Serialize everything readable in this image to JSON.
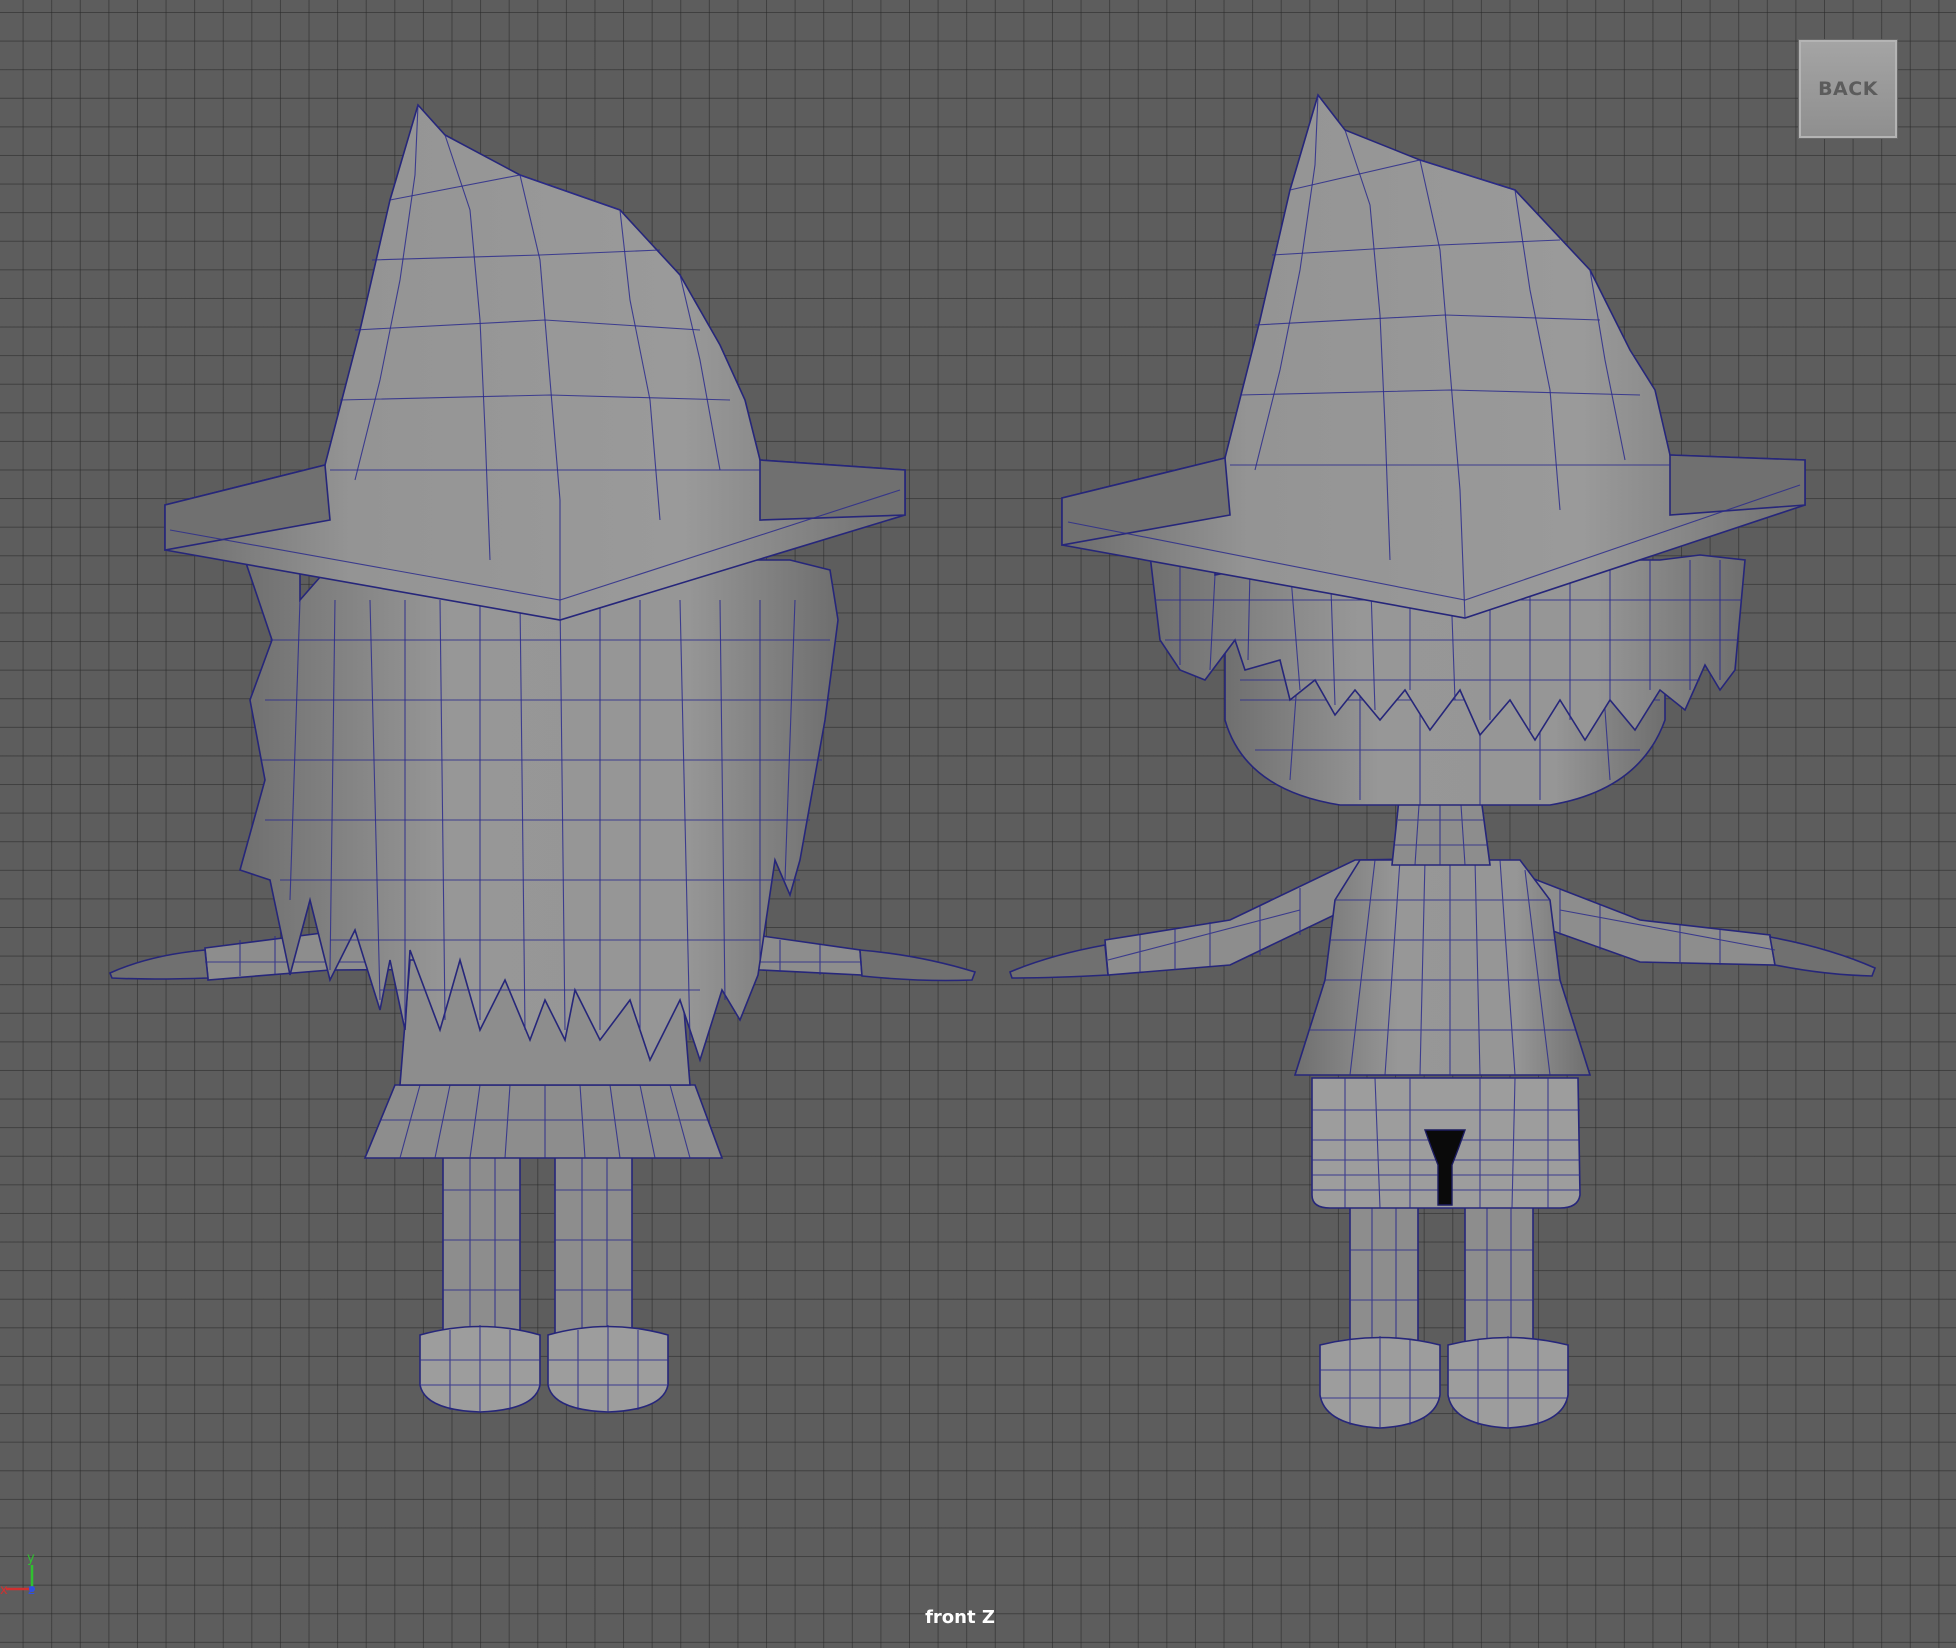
{
  "viewport": {
    "camera_label": "front Z",
    "back_button_label": "BACK",
    "axis": {
      "y": "y",
      "x": "x",
      "z": "z"
    },
    "colors": {
      "background": "#5d5d5d",
      "grid": "#3a3a3a",
      "mesh": "#8d8d8d",
      "wireframe": "#26267a",
      "axis_x": "#d03030",
      "axis_y": "#30c030",
      "axis_z": "#3050e0"
    }
  }
}
